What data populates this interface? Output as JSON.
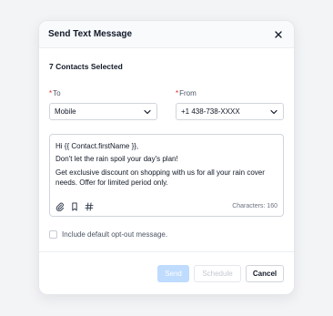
{
  "dialog": {
    "title": "Send Text Message",
    "close_icon": "close-icon"
  },
  "selection": {
    "count_label": "7 Contacts Selected"
  },
  "to_field": {
    "label": "To",
    "required_mark": "*",
    "value": "Mobile"
  },
  "from_field": {
    "label": "From",
    "required_mark": "*",
    "value": "+1 438-738-XXXX"
  },
  "message": {
    "lines": [
      "Hi {{ Contact.firstName }},",
      "Don't let the rain spoil your day's plan!",
      "Get exclusive discount on shopping with us for all your rain cover needs. Offer for limited period only."
    ],
    "characters_label": "Characters: 160",
    "tools": [
      "attachment-icon",
      "bookmark-icon",
      "hashtag-icon"
    ]
  },
  "optout": {
    "label": "Include default opt-out message.",
    "checked": false
  },
  "footer": {
    "send_label": "Send",
    "schedule_label": "Schedule",
    "cancel_label": "Cancel"
  },
  "colors": {
    "required": "#dc2626",
    "send_disabled": "#bfdbfe",
    "border": "#d1d5db"
  }
}
